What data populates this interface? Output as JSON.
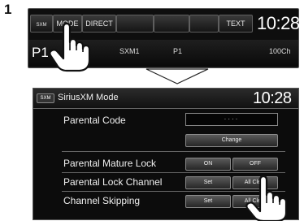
{
  "step_number": "1",
  "top_screen": {
    "sxm_logo": "SXM",
    "mode_label": "MODE",
    "direct_label": "DIRECT",
    "text_label": "TEXT",
    "clock": "10:28",
    "preset": "P1",
    "channel_name": "SXM1",
    "preset_small": "P1",
    "channel_number": "100Ch"
  },
  "bottom_screen": {
    "sxm_logo": "SXM",
    "title": "SiriusXM Mode",
    "clock": "10:28",
    "parental_code_label": "Parental Code",
    "parental_code_value": "····",
    "change_label": "Change",
    "mature_lock_label": "Parental Mature Lock",
    "on_label": "ON",
    "off_label": "OFF",
    "lock_channel_label": "Parental Lock Channel",
    "lock_channel_set": "Set",
    "lock_channel_all_clear": "All Clear",
    "skipping_label": "Channel Skipping",
    "skipping_set": "Set",
    "skipping_all_clear": "All Clear"
  },
  "icons": [
    "hand-pointer-icon",
    "down-arrow-icon"
  ]
}
